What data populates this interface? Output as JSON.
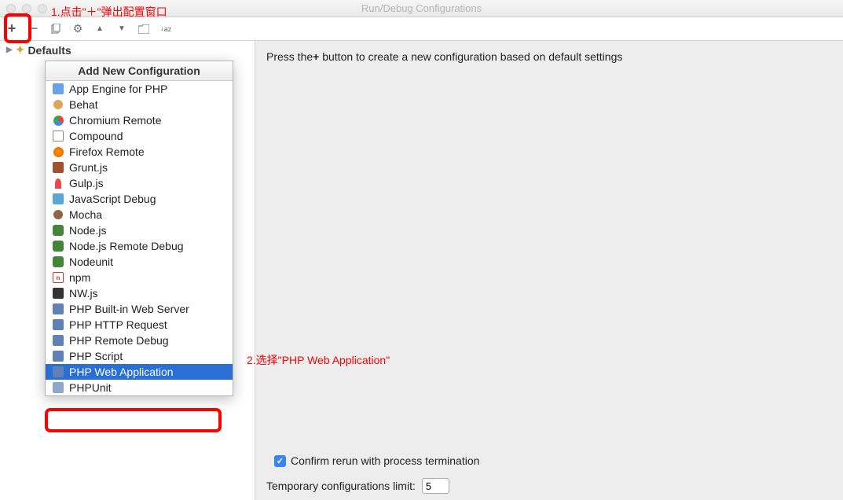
{
  "window": {
    "title": "Run/Debug Configurations"
  },
  "annotations": {
    "step1": "1.点击\"＋\"弹出配置窗口",
    "step2": "2.选择\"PHP Web Application\""
  },
  "tree": {
    "defaults": "Defaults"
  },
  "popup": {
    "title": "Add New Configuration",
    "items": [
      {
        "label": "App Engine for PHP",
        "icon": "appengine-icon"
      },
      {
        "label": "Behat",
        "icon": "behat-icon"
      },
      {
        "label": "Chromium Remote",
        "icon": "chrome-icon"
      },
      {
        "label": "Compound",
        "icon": "compound-icon"
      },
      {
        "label": "Firefox Remote",
        "icon": "firefox-icon"
      },
      {
        "label": "Grunt.js",
        "icon": "grunt-icon"
      },
      {
        "label": "Gulp.js",
        "icon": "gulp-icon"
      },
      {
        "label": "JavaScript Debug",
        "icon": "javascript-icon"
      },
      {
        "label": "Mocha",
        "icon": "mocha-icon"
      },
      {
        "label": "Node.js",
        "icon": "node-icon"
      },
      {
        "label": "Node.js Remote Debug",
        "icon": "node-icon"
      },
      {
        "label": "Nodeunit",
        "icon": "node-icon"
      },
      {
        "label": "npm",
        "icon": "npm-icon"
      },
      {
        "label": "NW.js",
        "icon": "nw-icon"
      },
      {
        "label": "PHP Built-in Web Server",
        "icon": "php-icon"
      },
      {
        "label": "PHP HTTP Request",
        "icon": "php-icon"
      },
      {
        "label": "PHP Remote Debug",
        "icon": "php-icon"
      },
      {
        "label": "PHP Script",
        "icon": "php-icon"
      },
      {
        "label": "PHP Web Application",
        "icon": "php-icon",
        "selected": true
      },
      {
        "label": "PHPUnit",
        "icon": "phpunit-icon"
      }
    ]
  },
  "right": {
    "hint_pre": "Press the",
    "hint_plus": "+",
    "hint_post": " button to create a new configuration based on default settings",
    "checkbox_label": "Confirm rerun with process termination",
    "checkbox_checked": true,
    "limit_label": "Temporary configurations limit:",
    "limit_value": "5"
  }
}
